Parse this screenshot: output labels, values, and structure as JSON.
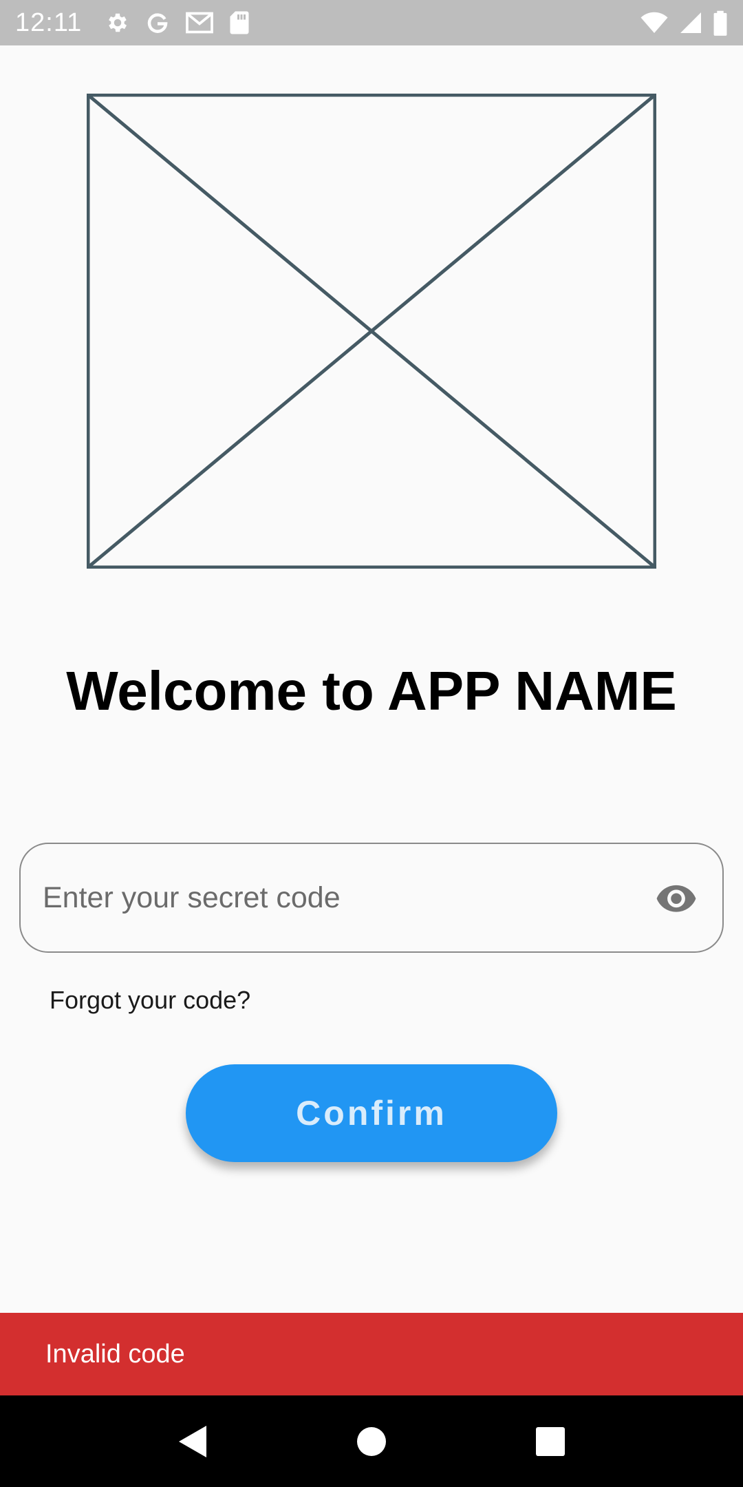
{
  "status_bar": {
    "time": "12:11",
    "left_icons": [
      "settings-icon",
      "google-icon",
      "gmail-icon",
      "sd-card-icon"
    ],
    "right_icons": [
      "wifi-icon",
      "cell-signal-icon",
      "battery-icon"
    ]
  },
  "hero": {
    "icon": "image-placeholder-icon"
  },
  "title": "Welcome to APP NAME",
  "code_input": {
    "placeholder": "Enter your secret code",
    "value": "",
    "toggle_icon": "eye-icon"
  },
  "forgot_link": "Forgot your code?",
  "confirm_button": "Confirm",
  "snackbar": {
    "message": "Invalid code",
    "color": "#d32f2f"
  },
  "nav_bar": {
    "icons": [
      "back-icon",
      "home-icon",
      "recents-icon"
    ]
  },
  "colors": {
    "accent": "#2196f3",
    "status_bar_bg": "#bdbdbd",
    "error": "#d32f2f",
    "placeholder_stroke": "#455a64"
  }
}
